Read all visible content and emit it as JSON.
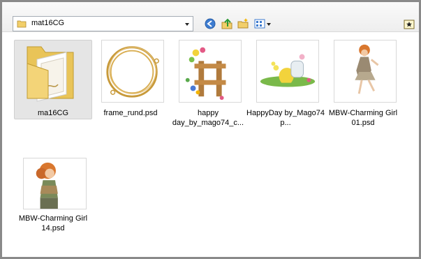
{
  "toolbar": {
    "path": "mat16CG",
    "icons": [
      "back-arrow-icon",
      "folder-up-icon",
      "new-folder-icon",
      "views-menu-icon",
      "favorites-icon"
    ]
  },
  "items": [
    {
      "label": "ma16CG",
      "type": "folder",
      "selected": true
    },
    {
      "label": "frame_rund.psd",
      "type": "file"
    },
    {
      "label": "happy day_by_mago74_c...",
      "type": "file"
    },
    {
      "label": "HappyDay by_Mago74 p...",
      "type": "file"
    },
    {
      "label": "MBW-Charming Girl 01.psd",
      "type": "file"
    },
    {
      "label": "MBW-Charming Girl 14.psd",
      "type": "file"
    }
  ],
  "colors": {
    "accent": "#3c7bd0",
    "folder": "#f2d06b",
    "frame_gold": "#c89a3a"
  }
}
